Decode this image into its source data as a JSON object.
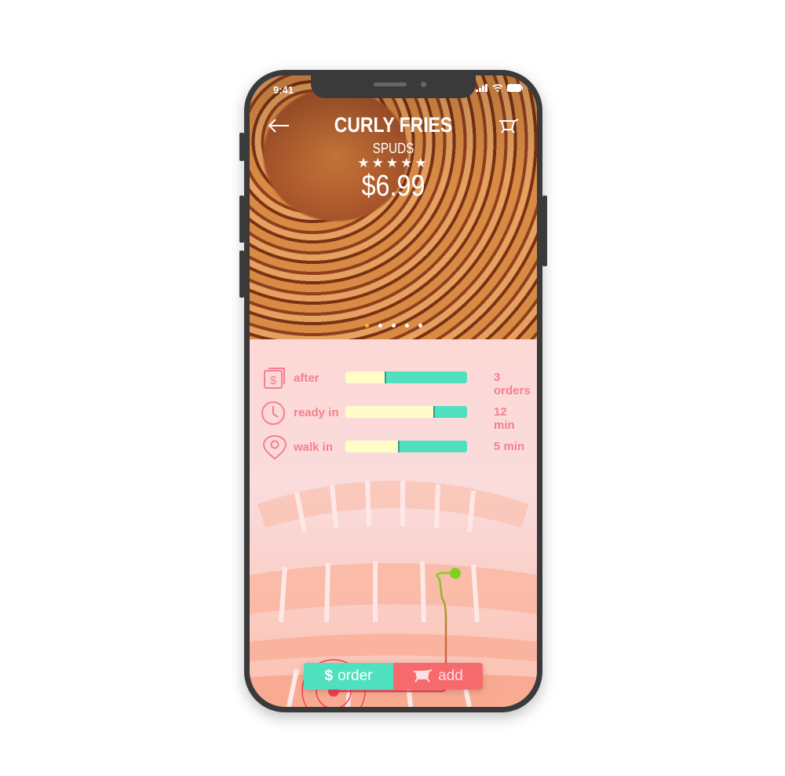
{
  "status_bar": {
    "time": "9:41"
  },
  "product": {
    "name": "CURLY FRIES",
    "vendor": "SPUDS",
    "rating": 5,
    "stars": "★★★★★",
    "price": "$6.99"
  },
  "carousel": {
    "count": 5,
    "active": 0
  },
  "stats": [
    {
      "icon": "dollar-receipt-icon",
      "label": "after",
      "value": "3 orders",
      "progress": 0.32
    },
    {
      "icon": "clock-icon",
      "label": "ready in",
      "value": "12 min",
      "progress": 0.72
    },
    {
      "icon": "location-pin-icon",
      "label": "walk in",
      "value": "5 min",
      "progress": 0.43
    }
  ],
  "actions": {
    "order_label": "order",
    "order_symbol": "$",
    "add_label": "add"
  },
  "colors": {
    "accent_green": "#4fe0bf",
    "accent_red": "#f66a6e",
    "text_pink": "#f4808e",
    "bar_empty": "#fffcc8"
  }
}
